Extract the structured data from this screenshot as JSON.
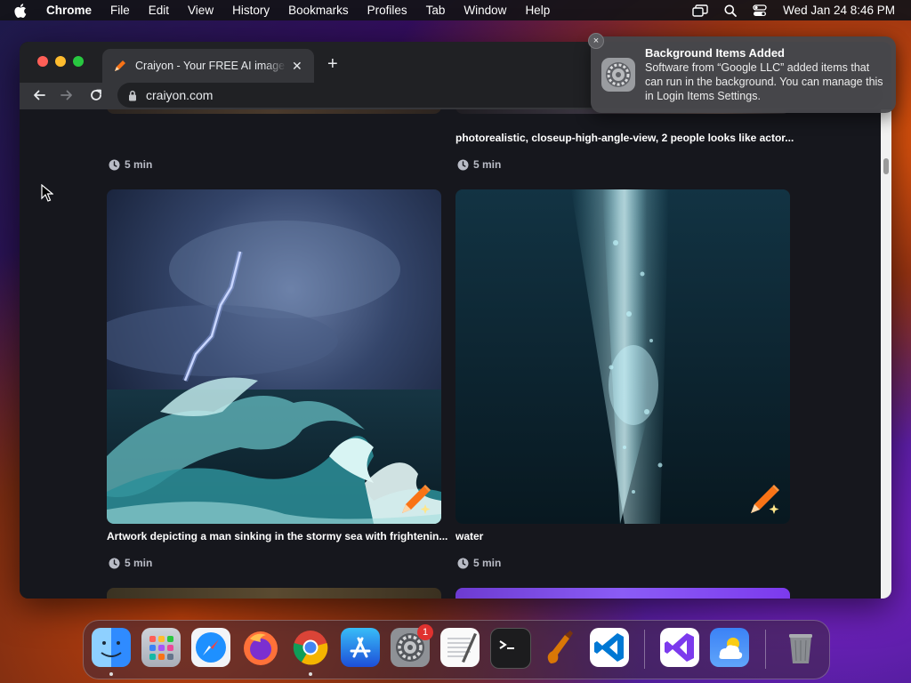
{
  "menubar": {
    "app_name": "Chrome",
    "items": [
      "File",
      "Edit",
      "View",
      "History",
      "Bookmarks",
      "Profiles",
      "Tab",
      "Window",
      "Help"
    ],
    "clock": "Wed Jan 24  8:46 PM",
    "status_icons": [
      "screen-mirroring-icon",
      "spotlight-search-icon",
      "control-center-icon"
    ]
  },
  "browser": {
    "tab_title": "Craiyon - Your FREE AI image generator",
    "new_tab": "+",
    "url": "craiyon.com"
  },
  "gallery": {
    "top_right_caption": "photorealistic, closeup-high-angle-view, 2 people looks like actor...",
    "top_left_time": "5 min",
    "top_right_time": "5 min",
    "cards": [
      {
        "caption": "Artwork depicting a man sinking in the stormy sea with frightenin...",
        "time": "5 min",
        "image": "stormy-sea-lightning"
      },
      {
        "caption": "water",
        "time": "5 min",
        "image": "underwater-light"
      }
    ]
  },
  "notification": {
    "title": "Background Items Added",
    "body": "Software from “Google LLC” added items that can run in the background. You can manage this in Login Items Settings.",
    "close": "×"
  },
  "dock": {
    "apps": [
      "Finder",
      "Launchpad",
      "Safari",
      "Firefox",
      "Google Chrome",
      "App Store",
      "System Settings",
      "TextEdit",
      "Terminal",
      "GarageBand",
      "Visual Studio Code",
      "Visual Studio",
      "Weather",
      "Trash"
    ],
    "settings_badge": "1"
  },
  "colors": {
    "accent_orange": "#f97316",
    "page_bg": "#16171d",
    "tab_bg": "#35363a"
  }
}
